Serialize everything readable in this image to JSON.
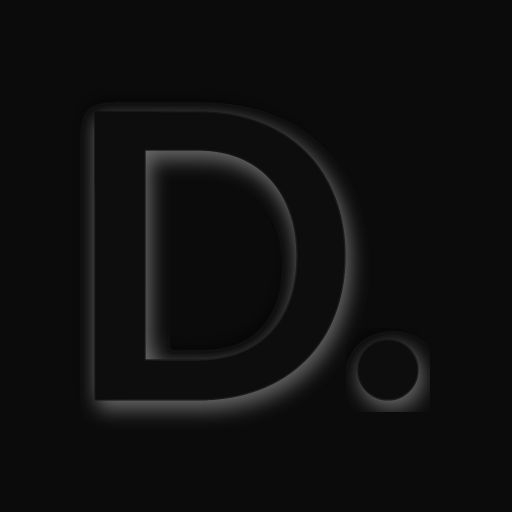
{
  "app_icon": {
    "logo_text": "D.",
    "icon": "letter-d-with-dot-logo-icon"
  },
  "colors": {
    "background": "#0b0b0b",
    "logo_fill": "#0a0a0a",
    "glow": "#bdbdbd",
    "rim": "#1a1a1a"
  }
}
